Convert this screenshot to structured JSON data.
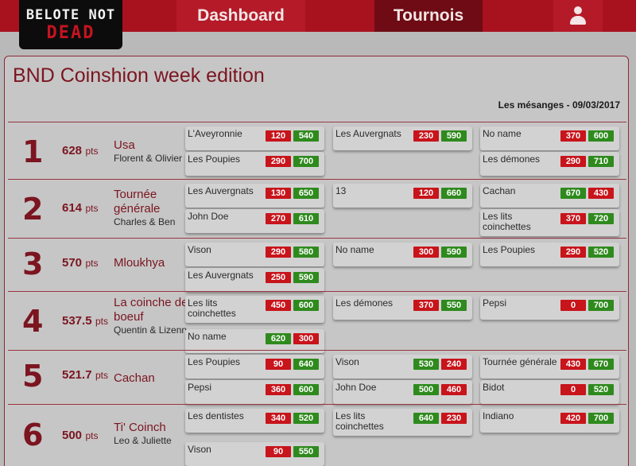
{
  "logo": {
    "line1": "BELOTE NOT",
    "line2": "DEAD"
  },
  "nav": {
    "dashboard": "Dashboard",
    "tournois": "Tournois",
    "user_icon": "user-icon"
  },
  "page": {
    "title": "BND Coinshion week edition",
    "subtitle": "Les mésanges - 09/03/2017"
  },
  "colors": {
    "header": "#a8121f",
    "accent": "#7b1520",
    "win": "#2f8a1e",
    "loss": "#c8141b"
  },
  "rankings": [
    {
      "rank": "1",
      "points": "628",
      "pts_label": "pts",
      "team": "Usa",
      "players": "Florent & Olivier",
      "matches": [
        {
          "opponent": "L'Aveyronnie",
          "score1": "120",
          "score2": "540"
        },
        {
          "opponent": "Les Auvergnats",
          "score1": "230",
          "score2": "590"
        },
        {
          "opponent": "No name",
          "score1": "370",
          "score2": "600"
        },
        {
          "opponent": "Les Poupies",
          "score1": "290",
          "score2": "700"
        },
        {
          "opponent": "Les démones",
          "score1": "290",
          "score2": "710"
        }
      ]
    },
    {
      "rank": "2",
      "points": "614",
      "pts_label": "pts",
      "team": "Tournée générale",
      "players": "Charles & Ben",
      "matches": [
        {
          "opponent": "Les Auvergnats",
          "score1": "130",
          "score2": "650"
        },
        {
          "opponent": "13",
          "score1": "120",
          "score2": "660"
        },
        {
          "opponent": "Cachan",
          "score1": "670",
          "score2": "430"
        },
        {
          "opponent": "John Doe",
          "score1": "270",
          "score2": "610"
        },
        {
          "opponent": "Les lits coinchettes",
          "score1": "370",
          "score2": "720"
        }
      ]
    },
    {
      "rank": "3",
      "points": "570",
      "pts_label": "pts",
      "team": "Mloukhya",
      "players": "",
      "matches": [
        {
          "opponent": "Vison",
          "score1": "290",
          "score2": "580"
        },
        {
          "opponent": "No name",
          "score1": "300",
          "score2": "590"
        },
        {
          "opponent": "Les Poupies",
          "score1": "290",
          "score2": "520"
        },
        {
          "opponent": "Les Auvergnats",
          "score1": "250",
          "score2": "590"
        }
      ]
    },
    {
      "rank": "4",
      "points": "537.5",
      "pts_label": "pts",
      "team": "La coinche de boeuf",
      "players": "Quentin & Lizenn",
      "matches": [
        {
          "opponent": "Les lits coinchettes",
          "score1": "450",
          "score2": "600"
        },
        {
          "opponent": "Les démones",
          "score1": "370",
          "score2": "550"
        },
        {
          "opponent": "Pepsi",
          "score1": "0",
          "score2": "700"
        },
        {
          "opponent": "No name",
          "score1": "620",
          "score2": "300"
        }
      ]
    },
    {
      "rank": "5",
      "points": "521.7",
      "pts_label": "pts",
      "team": "Cachan",
      "players": "",
      "matches": [
        {
          "opponent": "Les Poupies",
          "score1": "90",
          "score2": "640"
        },
        {
          "opponent": "Vison",
          "score1": "530",
          "score2": "240"
        },
        {
          "opponent": "Tournée générale",
          "score1": "430",
          "score2": "670"
        },
        {
          "opponent": "Pepsi",
          "score1": "360",
          "score2": "600"
        },
        {
          "opponent": "John Doe",
          "score1": "500",
          "score2": "460"
        },
        {
          "opponent": "Bidot",
          "score1": "0",
          "score2": "520"
        }
      ]
    },
    {
      "rank": "6",
      "points": "500",
      "pts_label": "pts",
      "team": "Ti' Coinch",
      "players": "Leo & Juliette",
      "matches": [
        {
          "opponent": "Les dentistes",
          "score1": "340",
          "score2": "520"
        },
        {
          "opponent": "Les lits coinchettes",
          "score1": "640",
          "score2": "230"
        },
        {
          "opponent": "Indiano",
          "score1": "420",
          "score2": "700"
        },
        {
          "opponent": "Vison",
          "score1": "90",
          "score2": "550"
        }
      ]
    }
  ]
}
